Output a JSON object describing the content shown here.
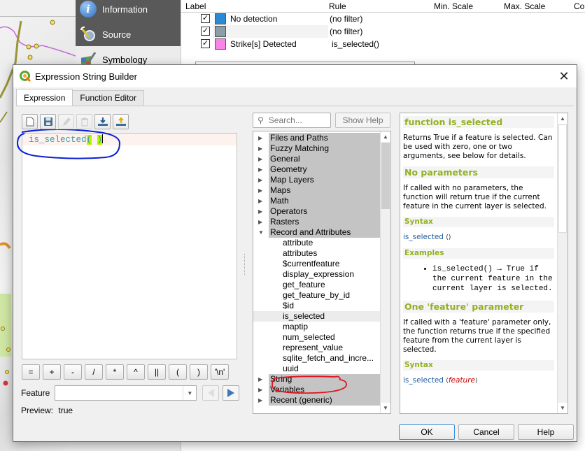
{
  "background": {
    "layer_props_sidebar": {
      "items": [
        {
          "label": "Information",
          "icon": "info-icon"
        },
        {
          "label": "Source",
          "icon": "wrench-gear-icon"
        },
        {
          "label": "Symbology",
          "icon": "paintbrush-icon"
        }
      ]
    },
    "rules_table": {
      "columns": [
        "Label",
        "Rule",
        "Min. Scale",
        "Max. Scale",
        "Cou"
      ],
      "rows": [
        {
          "checked": true,
          "color": "#2b8ad6",
          "label": "No detection",
          "rule": "(no filter)"
        },
        {
          "checked": true,
          "color": "#8b9ea8",
          "label": "",
          "rule": "(no filter)"
        },
        {
          "checked": true,
          "color": "#f984e9",
          "label": "Strike[s] Detected",
          "rule": "is_selected()"
        }
      ]
    }
  },
  "dialog": {
    "title": "Expression String Builder",
    "close_label": "✕",
    "tabs": [
      {
        "label": "Expression",
        "active": true
      },
      {
        "label": "Function Editor",
        "active": false
      }
    ],
    "editor": {
      "fn_name": "is_selected",
      "open_paren": "(",
      "space": " ",
      "close_paren": ")"
    },
    "operators": [
      "=",
      "+",
      "-",
      "/",
      "*",
      "^",
      "||",
      "(",
      ")",
      "'\\n'"
    ],
    "feature_label": "Feature",
    "feature_value": "",
    "preview_label": "Preview:",
    "preview_value": "true",
    "search_placeholder": "Search...",
    "show_help_label": "Show Help",
    "function_tree": {
      "groups_before": [
        "Files and Paths",
        "Fuzzy Matching",
        "General",
        "Geometry",
        "Map Layers",
        "Maps",
        "Math",
        "Operators",
        "Rasters"
      ],
      "expanded_group": "Record and Attributes",
      "expanded_items": [
        "attribute",
        "attributes",
        "$currentfeature",
        "display_expression",
        "get_feature",
        "get_feature_by_id",
        "$id",
        "is_selected",
        "maptip",
        "num_selected",
        "represent_value",
        "sqlite_fetch_and_incre...",
        "uuid"
      ],
      "selected_item": "is_selected",
      "groups_after": [
        "String",
        "Variables",
        "Recent (generic)"
      ]
    },
    "help": {
      "title": "function is_selected",
      "intro": "Returns True if a feature is selected. Can be used with zero, one or two arguments, see below for details.",
      "section1": {
        "heading": "No parameters",
        "text": "If called with no parameters, the function will return true if the current feature in the current layer is selected.",
        "syntax_heading": "Syntax",
        "syntax_fn": "is_selected",
        "syntax_args": "()",
        "examples_heading": "Examples",
        "example": "is_selected() → True if the current feature in the current layer is selected."
      },
      "section2": {
        "heading": "One 'feature' parameter",
        "text": "If called with a 'feature' parameter only, the function returns true if the specified feature from the current layer is selected.",
        "syntax_heading": "Syntax",
        "syntax_fn": "is_selected",
        "syntax_open": "(",
        "syntax_arg": "feature",
        "syntax_close": ")"
      }
    },
    "buttons": {
      "ok": "OK",
      "cancel": "Cancel",
      "help": "Help"
    }
  }
}
